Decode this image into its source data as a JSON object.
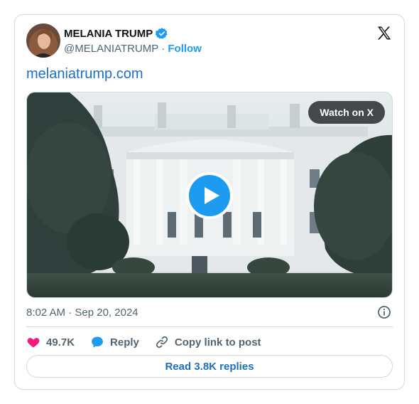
{
  "author": {
    "name": "MELANIA TRUMP",
    "handle": "@MELANIATRUMP",
    "follow_label": "Follow"
  },
  "separator": "·",
  "tweet": {
    "link_text": "melaniatrump.com"
  },
  "media": {
    "watch_label": "Watch on X"
  },
  "meta": {
    "time": "8:02 AM",
    "date": "Sep 20, 2024"
  },
  "actions": {
    "likes": "49.7K",
    "reply_label": "Reply",
    "copy_label": "Copy link to post"
  },
  "read_replies_label": "Read 3.8K replies",
  "colors": {
    "accent": "#1d9bf0",
    "link": "#1d6fc0",
    "like": "#f91880",
    "muted": "#536471"
  },
  "icons": [
    "verified-badge-icon",
    "x-logo-icon",
    "play-icon",
    "info-icon",
    "heart-icon",
    "reply-bubble-icon",
    "link-icon"
  ]
}
